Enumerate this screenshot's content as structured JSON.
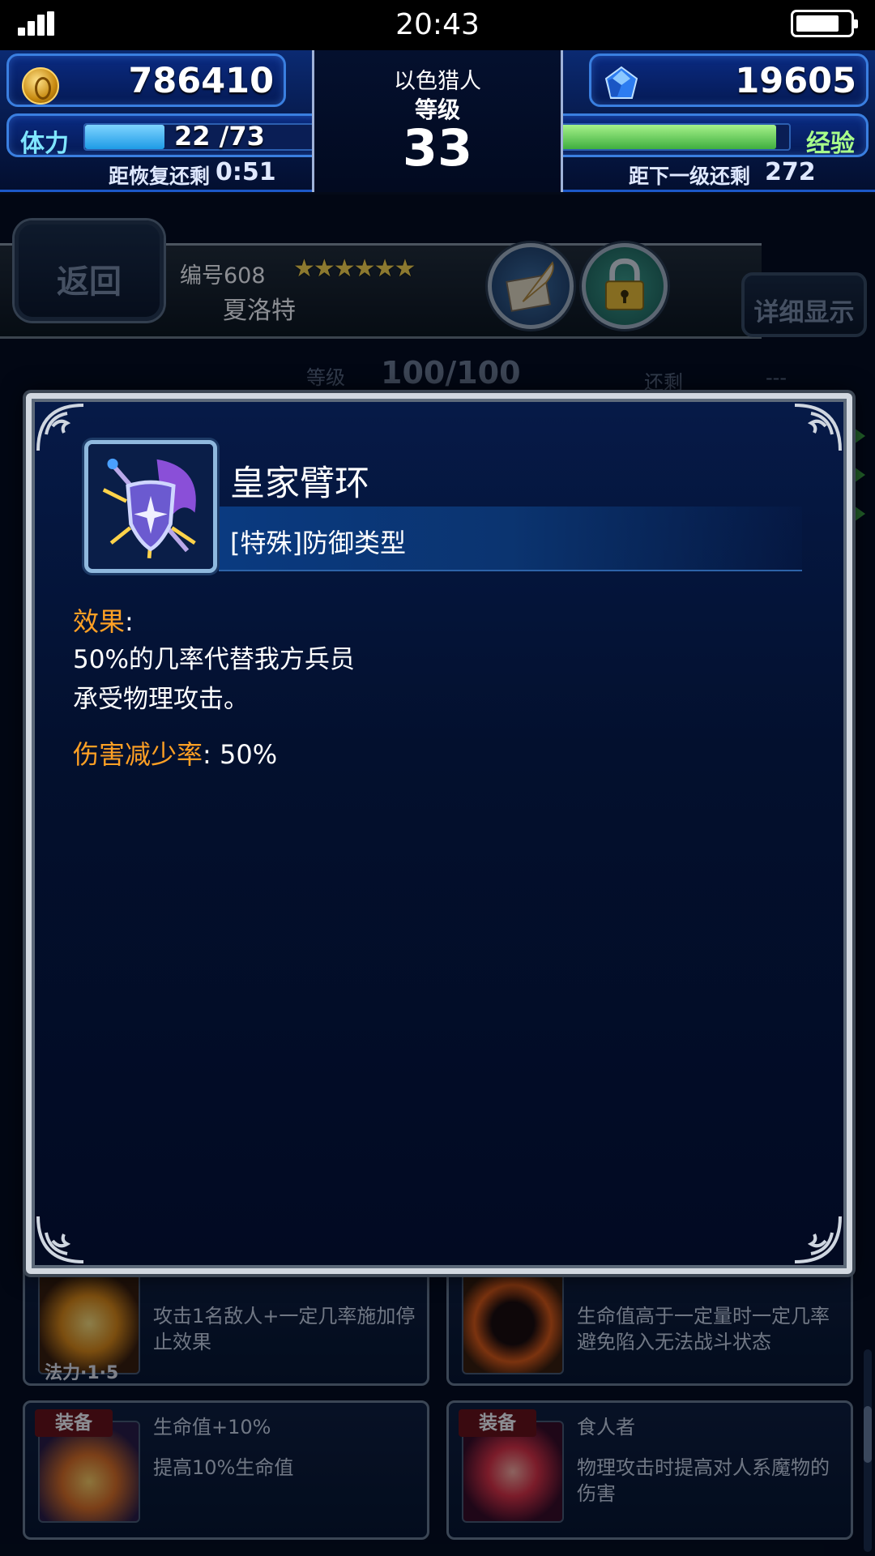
{
  "status_bar": {
    "time": "20:43"
  },
  "header": {
    "gil": "786410",
    "gems": "19605",
    "player_name": "以色猎人",
    "rank_label": "等级",
    "rank": "33",
    "stamina_label": "体力",
    "stamina_value": "22 /73",
    "stamina_fraction": 0.3,
    "recover_label": "距恢复还剩",
    "recover_time": "0:51",
    "exp_label": "经验",
    "exp_fraction": 0.95,
    "next_level_label": "距下一级还剩",
    "next_level_value": "272"
  },
  "character": {
    "back_label": "返回",
    "number": "编号608",
    "stars": "★★★★★★",
    "name": "夏洛特",
    "detail_label": "详细显示"
  },
  "background": {
    "level_label": "等级",
    "level_value": "100/100",
    "remain_label": "还剩",
    "remain_value": "---"
  },
  "skill_popup": {
    "title": "皇家臂环",
    "type": "[特殊]防御类型",
    "effect_label": "效果",
    "effect_colon": ":",
    "description_line1": "50%的几率代替我方兵员",
    "description_line2": "承受物理攻击。",
    "damage_label": "伤害减少率",
    "damage_value": ": 50%"
  },
  "cards": [
    {
      "title": "",
      "desc": "攻击1名敌人+一定几率施加停止效果",
      "cost": "法力·1·5"
    },
    {
      "title": "",
      "desc": "生命值高于一定量时一定几率避免陷入无法战斗状态"
    },
    {
      "tag": "装备",
      "title": "生命值+10%",
      "desc": "提高10%生命值"
    },
    {
      "tag": "装备",
      "title": "食人者",
      "desc": "物理攻击时提高对人系魔物的伤害"
    }
  ],
  "colors": {
    "accent_orange": "#ffa024",
    "stamina_bar": "#36b4f4",
    "exp_bar": "#5dc95a",
    "star_gold": "#ffd94a"
  },
  "icons": [
    "signal-icon",
    "battery-icon",
    "gil-coin-icon",
    "gem-icon",
    "quill-book-icon",
    "lock-icon",
    "shield-skill-icon"
  ]
}
